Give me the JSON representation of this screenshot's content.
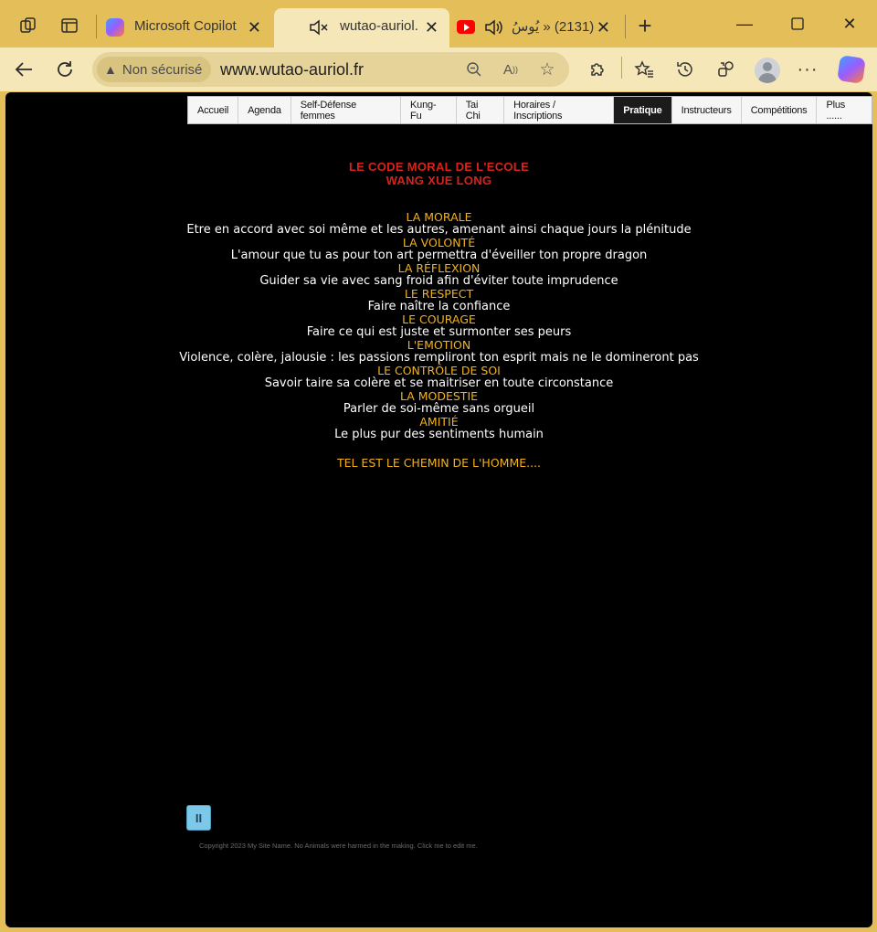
{
  "browser": {
    "tabs": [
      {
        "label": "Microsoft Copilot",
        "active": false
      },
      {
        "label": "wutao-auriol.fr",
        "active": true
      },
      {
        "label": "(2131) « يُوسُ",
        "active": false
      }
    ],
    "security_label": "Non sécurisé",
    "url": "www.wutao-auriol.fr",
    "colors": {
      "frame": "#e4be58",
      "toolbar": "#f6e7b8"
    }
  },
  "site": {
    "nav": [
      {
        "label": "Accueil",
        "active": false
      },
      {
        "label": "Agenda",
        "active": false
      },
      {
        "label": "Self-Défense femmes",
        "active": false
      },
      {
        "label": "Kung-Fu",
        "active": false
      },
      {
        "label": "Tai Chi",
        "active": false
      },
      {
        "label": "Horaires / Inscriptions",
        "active": false
      },
      {
        "label": "Pratique",
        "active": true
      },
      {
        "label": "Instructeurs",
        "active": false
      },
      {
        "label": "Compétitions",
        "active": false
      },
      {
        "label": "Plus ......",
        "active": false
      }
    ],
    "title_line1": "LE CODE MORAL DE L'ECOLE",
    "title_line2": "WANG XUE LONG",
    "virtues": [
      {
        "name": "LA MORALE",
        "desc": "Etre en accord avec soi même et les autres, amenant ainsi chaque jours la plénitude"
      },
      {
        "name": "LA VOLONTÉ",
        "desc": "L'amour que tu as pour ton art permettra d'éveiller ton propre dragon"
      },
      {
        "name": "LA RÉFLEXION",
        "desc": "Guider sa vie avec sang froid afin d'éviter toute imprudence"
      },
      {
        "name": "LE RESPECT",
        "desc": "Faire naître la confiance"
      },
      {
        "name": "LE COURAGE",
        "desc": "Faire ce qui est juste et surmonter ses peurs"
      },
      {
        "name": "L'EMOTION",
        "desc": "Violence, colère, jalousie : les passions rempliront ton esprit mais ne le domineront pas"
      },
      {
        "name": "LE CONTRÔLE DE SOI",
        "desc": "Savoir taire sa colère et se maitriser en toute circonstance"
      },
      {
        "name": "LA MODESTIE",
        "desc": "Parler de soi-même sans orgueil"
      },
      {
        "name": "AMITIÉ",
        "desc": "Le plus pur des sentiments humain"
      }
    ],
    "closing": "TEL EST LE CHEMIN DE L'HOMME....",
    "player_glyph": "II",
    "footer": "Copyright 2023 My Site Name. No Animals were harmed in the making. Click me to edit me.",
    "colors": {
      "title": "#d8231a",
      "virtue": "#f3b21a",
      "text": "#ffffff",
      "background": "#000000"
    }
  }
}
